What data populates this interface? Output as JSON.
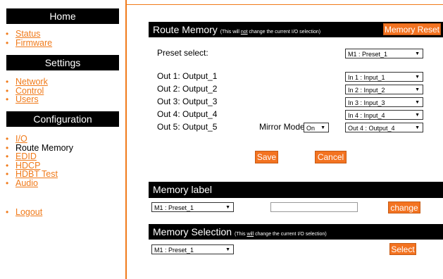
{
  "sidebar": {
    "home": {
      "heading": "Home",
      "items": [
        {
          "label": "Status"
        },
        {
          "label": "Firmware"
        }
      ]
    },
    "settings": {
      "heading": "Settings",
      "items": [
        {
          "label": "Network"
        },
        {
          "label": "Control"
        },
        {
          "label": "Users"
        }
      ]
    },
    "configuration": {
      "heading": "Configuration",
      "items": [
        {
          "label": "I/O"
        },
        {
          "label": "Route Memory"
        },
        {
          "label": "EDID"
        },
        {
          "label": "HDCP"
        },
        {
          "label": "HDBT Test"
        },
        {
          "label": "Audio"
        }
      ]
    },
    "logout": "Logout"
  },
  "route_memory": {
    "title": "Route Memory",
    "note_pre": "(This will ",
    "note_emph": "not",
    "note_post": " change the current I/O selection)",
    "reset_label": "Memory Reset",
    "preset_label": "Preset select:",
    "preset_value": "M1 : Preset_1",
    "outputs": [
      {
        "label": "Out 1: Output_1",
        "value": "In 1 : Input_1"
      },
      {
        "label": "Out 2: Output_2",
        "value": "In 2 : Input_2"
      },
      {
        "label": "Out 3: Output_3",
        "value": "In 3 : Input_3"
      },
      {
        "label": "Out 4: Output_4",
        "value": "In 4 : Input_4"
      },
      {
        "label": "Out 5: Output_5",
        "value": "Out 4 : Output_4"
      }
    ],
    "mirror_label": "Mirror Mode",
    "mirror_value": "On",
    "save_label": "Save",
    "cancel_label": "Cancel"
  },
  "memory_label": {
    "title": "Memory label",
    "select_value": "M1 : Preset_1",
    "input_value": "",
    "change_label": "change"
  },
  "memory_selection": {
    "title": "Memory Selection",
    "note_pre": "(This ",
    "note_emph": "will",
    "note_post": " change the current I/O selection)",
    "select_value": "M1 : Preset_1",
    "select_label": "Select"
  },
  "colors": {
    "accent": "#f37321",
    "bar": "#000000"
  },
  "icons": {
    "dropdown": "chevron-down-icon",
    "bullet": "bullet-icon"
  }
}
